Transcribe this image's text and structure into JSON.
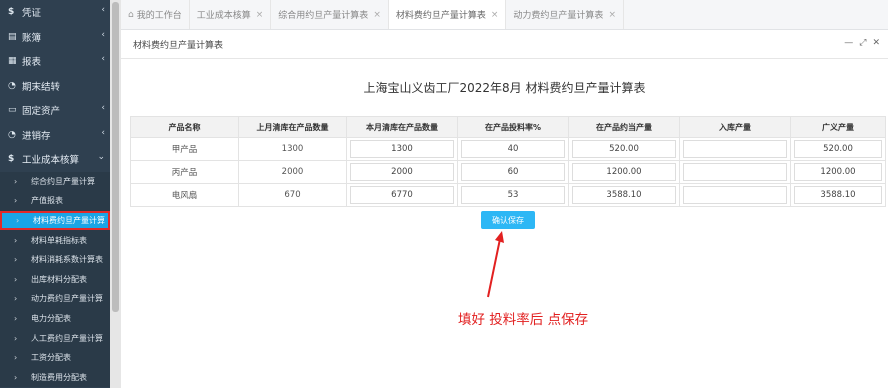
{
  "sidebar": {
    "top_items": [
      {
        "icon": "$",
        "label": "凭证"
      },
      {
        "icon": "▤",
        "label": "账簿"
      },
      {
        "icon": "▦",
        "label": "报表"
      },
      {
        "icon": "◔",
        "label": "期末结转"
      },
      {
        "icon": "▭",
        "label": "固定资产"
      },
      {
        "icon": "◔",
        "label": "进销存"
      },
      {
        "icon": "$",
        "label": "工业成本核算"
      }
    ],
    "sub_items": [
      "综合约旦产量计算",
      "产值报表",
      "材料费约旦产量计算",
      "材料单耗指标表",
      "材料消耗系数计算表",
      "出库材料分配表",
      "动力费约旦产量计算",
      "电力分配表",
      "人工费约旦产量计算",
      "工资分配表",
      "制造费用分配表"
    ]
  },
  "tabs": [
    {
      "label": "我的工作台"
    },
    {
      "label": "工业成本核算"
    },
    {
      "label": "综合用约旦产量计算表"
    },
    {
      "label": "材料费约旦产量计算表"
    },
    {
      "label": "动力费约旦产量计算表"
    }
  ],
  "panel": {
    "title": "材料费约旦产量计算表"
  },
  "report": {
    "title": "上海宝山义齿工厂2022年8月 材料费约旦产量计算表",
    "columns": [
      "产品名称",
      "上月清库在产品数量",
      "本月清库在产品数量",
      "在产品投料率%",
      "在产品约当产量",
      "入库产量",
      "广义产量"
    ],
    "rows": [
      {
        "name": "甲产品",
        "last": "1300",
        "current": "1300",
        "rate": "40",
        "equiv": "520.00",
        "stock": "",
        "total": "520.00"
      },
      {
        "name": "丙产品",
        "last": "2000",
        "current": "2000",
        "rate": "60",
        "equiv": "1200.00",
        "stock": "",
        "total": "1200.00"
      },
      {
        "name": "电风扇",
        "last": "670",
        "current": "6770",
        "rate": "53",
        "equiv": "3588.10",
        "stock": "",
        "total": "3588.10"
      }
    ],
    "save_label": "确认保存"
  },
  "annotation": {
    "text": "填好 投料率后  点保存",
    "color": "#e22020"
  }
}
